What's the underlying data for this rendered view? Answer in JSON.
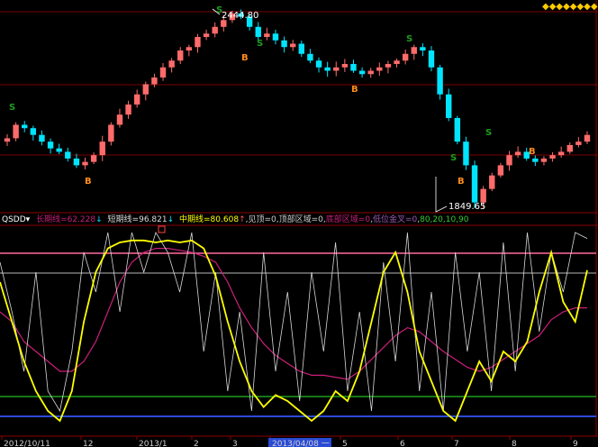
{
  "colors": {
    "background": "#000000",
    "up": "#ff6b6b",
    "down": "#00e5ff",
    "frame": "#8b0000",
    "qsdd_long": "#cc1f7a",
    "qsdd_short": "#ffffff",
    "qsdd_mid": "#ffff00",
    "line_top": "#ff6a9a",
    "line_upper": "#c8c8c8",
    "line_low": "#1e9e1e",
    "line_bottom": "#2a4bd6"
  },
  "top_panel": {
    "high_price": "2444.80",
    "low_price": "1849.65",
    "signal_s": "S",
    "signal_b": "B",
    "scroll_indicator": "◆◆◆◆◆◆◆◆"
  },
  "indicator_bar": {
    "name": "QSDD",
    "dropdown_icon": "chevron-down-icon",
    "long_label": "长期线=62.228",
    "long_arrow": "↓",
    "short_label": "短期线=96.821",
    "short_arrow": "↓",
    "mid_label": "中期线=80.608",
    "mid_arrow": "↑",
    "see_top": "见顶=0",
    "top_zone": "顶部区域=0",
    "bottom_zone": "底部区域=0",
    "low_buy": "低位金叉=0",
    "levels": "80,20,10,90"
  },
  "time_axis": {
    "labels": [
      "2012/10/11",
      "12",
      "2013/1",
      "2",
      "3",
      "2013/04/08 一",
      "5",
      "6",
      "7",
      "8",
      "9"
    ],
    "selected": "2013/04/08 一"
  },
  "chart_data": [
    {
      "type": "candlestick",
      "title": "",
      "annotations": {
        "max": "2444.80",
        "min": "1849.65"
      },
      "series": [
        {
          "name": "price_close",
          "values": [
            2070,
            2110,
            2100,
            2080,
            2060,
            2040,
            2030,
            2010,
            1990,
            2000,
            2020,
            2060,
            2110,
            2140,
            2170,
            2200,
            2230,
            2250,
            2280,
            2300,
            2330,
            2340,
            2370,
            2380,
            2400,
            2420,
            2440,
            2430,
            2400,
            2370,
            2380,
            2360,
            2340,
            2350,
            2320,
            2300,
            2280,
            2270,
            2280,
            2290,
            2270,
            2260,
            2270,
            2280,
            2290,
            2300,
            2320,
            2340,
            2330,
            2280,
            2200,
            2130,
            2060,
            1990,
            1880,
            1920,
            1960,
            1990,
            2020,
            2030,
            2010,
            2000,
            2010,
            2020,
            2030,
            2050,
            2060,
            2080
          ]
        }
      ]
    },
    {
      "type": "line",
      "title": "",
      "ylim": [
        0,
        100
      ],
      "reference_levels": [
        90,
        80,
        20,
        10
      ],
      "series": [
        {
          "name": "长期线",
          "values": [
            60,
            55,
            45,
            40,
            35,
            30,
            30,
            35,
            45,
            60,
            75,
            85,
            90,
            92,
            92,
            91,
            90,
            88,
            85,
            75,
            62,
            52,
            44,
            38,
            34,
            30,
            28,
            28,
            27,
            26,
            30,
            36,
            42,
            48,
            52,
            50,
            45,
            40,
            36,
            32,
            30,
            32,
            36,
            40,
            44,
            48,
            56,
            60,
            62,
            62
          ]
        },
        {
          "name": "短期线",
          "values": [
            85,
            60,
            30,
            80,
            20,
            10,
            40,
            90,
            70,
            100,
            60,
            100,
            80,
            100,
            90,
            70,
            100,
            40,
            80,
            20,
            60,
            10,
            90,
            30,
            70,
            15,
            80,
            40,
            95,
            20,
            60,
            10,
            85,
            35,
            100,
            20,
            70,
            10,
            90,
            40,
            80,
            20,
            95,
            30,
            100,
            50,
            90,
            70,
            100,
            97
          ]
        },
        {
          "name": "中期线",
          "values": [
            75,
            55,
            35,
            20,
            10,
            5,
            20,
            55,
            80,
            92,
            95,
            96,
            96,
            95,
            96,
            95,
            96,
            92,
            78,
            55,
            35,
            20,
            12,
            18,
            15,
            10,
            5,
            10,
            20,
            15,
            30,
            55,
            80,
            90,
            70,
            40,
            25,
            10,
            5,
            20,
            35,
            25,
            40,
            35,
            45,
            70,
            90,
            65,
            55,
            81
          ]
        }
      ]
    }
  ]
}
